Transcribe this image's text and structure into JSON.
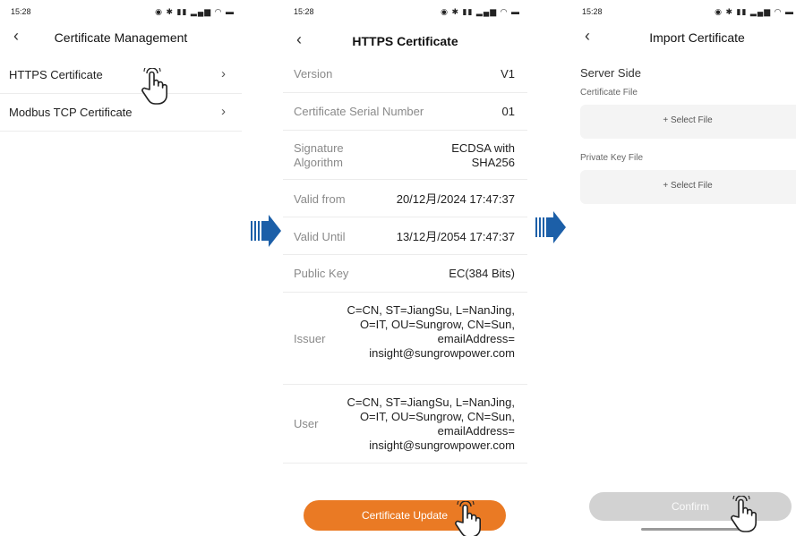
{
  "screen1": {
    "status_time": "15:28",
    "title": "Certificate Management",
    "items": [
      {
        "label": "HTTPS Certificate"
      },
      {
        "label": "Modbus TCP Certificate"
      }
    ]
  },
  "screen2": {
    "status_time": "15:28",
    "title": "HTTPS Certificate",
    "rows": [
      {
        "key": "Version",
        "value": "V1"
      },
      {
        "key": "Certificate Serial Number",
        "value": "01"
      },
      {
        "key": "Signature Algorithm",
        "value": "ECDSA with SHA256"
      },
      {
        "key": "Valid from",
        "value": "20/12月/2024 17:47:37"
      },
      {
        "key": "Valid Until",
        "value": "13/12月/2054 17:47:37"
      },
      {
        "key": "Public Key",
        "value": "EC(384 Bits)"
      },
      {
        "key": "Issuer",
        "value": "C=CN, ST=JiangSu, L=NanJing, O=IT, OU=Sungrow, CN=Sun, emailAddress= insight@sungrowpower.com"
      },
      {
        "key": "User",
        "value": "C=CN, ST=JiangSu, L=NanJing, O=IT, OU=Sungrow, CN=Sun, emailAddress= insight@sungrowpower.com"
      }
    ],
    "update_button": "Certificate Update"
  },
  "screen3": {
    "status_time": "15:28",
    "title": "Import Certificate",
    "section": "Server Side",
    "cert_label": "Certificate File",
    "cert_select": "+ Select File",
    "key_label": "Private Key File",
    "key_select": "+ Select File",
    "confirm_button": "Confirm"
  },
  "colors": {
    "accent": "#ea7a24",
    "arrow": "#1c5fa8",
    "disabled_button": "#d2d2d2"
  }
}
